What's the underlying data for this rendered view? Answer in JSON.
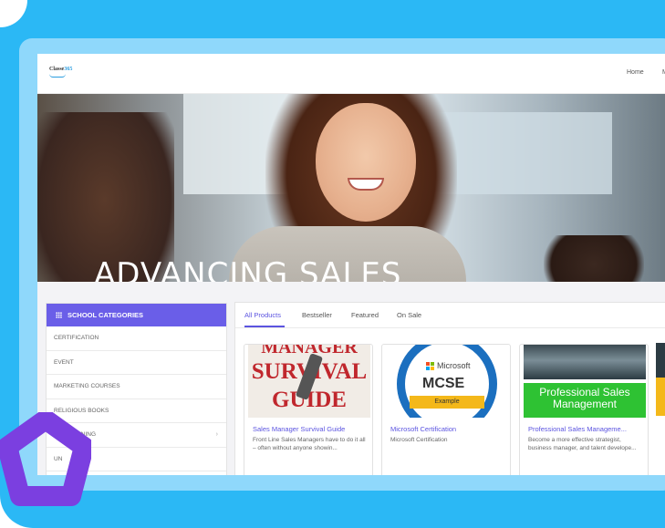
{
  "header": {
    "logo": {
      "main": "Classe",
      "accent": "365"
    },
    "nav": {
      "home": "Home",
      "next": "M"
    }
  },
  "hero": {
    "title": "ADVANCING SALES"
  },
  "sidebar": {
    "title": "SCHOOL CATEGORIES",
    "items": [
      {
        "label": "CERTIFICATION"
      },
      {
        "label": "EVENT"
      },
      {
        "label": "MARKETING COURSES"
      },
      {
        "label": "RELIGIOUS BOOKS"
      },
      {
        "label": "TRAINING",
        "chevron": "›"
      },
      {
        "label": "UN"
      }
    ]
  },
  "products": {
    "tabs": [
      {
        "label": "All Products",
        "active": true
      },
      {
        "label": "Bestseller"
      },
      {
        "label": "Featured"
      },
      {
        "label": "On Sale"
      }
    ],
    "cards": [
      {
        "title": "Sales Manager Survival Guide",
        "description": "Front Line Sales Managers have to do it all – often without anyone showin...",
        "image_text": [
          "MANAGER",
          "SURVIVAL",
          "GUIDE"
        ]
      },
      {
        "title": "Microsoft Certification",
        "description": "Microsoft Certification",
        "image_text": {
          "brand": "Microsoft",
          "badge": "MCSE",
          "ribbon": "Example"
        }
      },
      {
        "title": "Professional Sales Manageme...",
        "description": "Become a more effective strategist, business manager, and talent develope...",
        "image_text": {
          "line1": "Professional Sales",
          "line2": "Management"
        }
      }
    ]
  },
  "colors": {
    "accent": "#6a5ee8",
    "frame_bg": "#2bb8f5",
    "pentagon": "#7b3fe0"
  }
}
